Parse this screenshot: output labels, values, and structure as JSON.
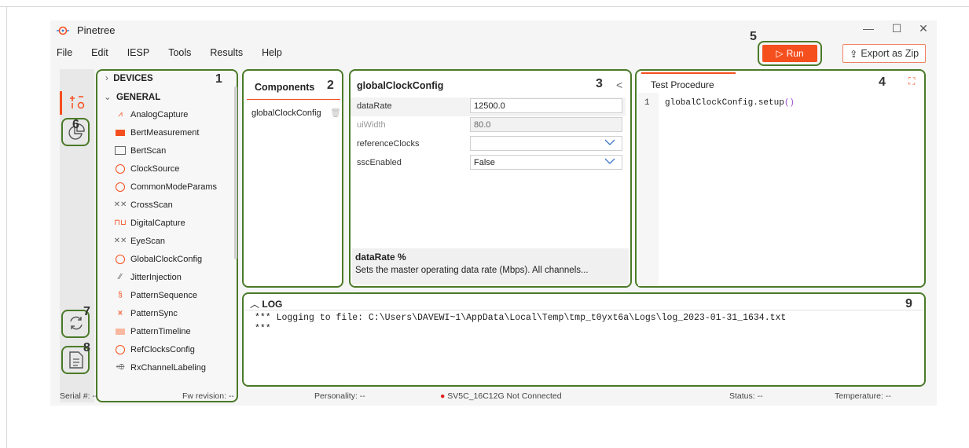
{
  "window": {
    "title": "Pinetree",
    "minimize": "—",
    "maximize": "☐",
    "close": "✕"
  },
  "menu": [
    "File",
    "Edit",
    "IESP",
    "Tools",
    "Results",
    "Help"
  ],
  "toolbar": {
    "run_label": "Run",
    "run_icon": "▷",
    "export_label": "Export as Zip",
    "export_icon": "⇪"
  },
  "colors": {
    "accent": "#f54f1e",
    "callout_border": "#4a7a28",
    "link_blue": "#3a78c8"
  },
  "callouts": {
    "c1": "1",
    "c2": "2",
    "c3": "3",
    "c4": "4",
    "c5": "5",
    "c6": "6",
    "c7": "7",
    "c8": "8",
    "c9": "9"
  },
  "tree": {
    "devices": "DEVICES",
    "general": "GENERAL",
    "items": [
      "AnalogCapture",
      "BertMeasurement",
      "BertScan",
      "ClockSource",
      "CommonModeParams",
      "CrossScan",
      "DigitalCapture",
      "EyeScan",
      "GlobalClockConfig",
      "JitterInjection",
      "PatternSequence",
      "PatternSync",
      "PatternTimeline",
      "RefClocksConfig",
      "RxChannelLabeling"
    ]
  },
  "components": {
    "title": "Components",
    "items": [
      "globalClockConfig"
    ]
  },
  "config": {
    "title": "globalClockConfig",
    "collapse_icon": "<",
    "props": [
      {
        "name": "dataRate",
        "value": "12500.0"
      },
      {
        "name": "uiWidth",
        "value": "80.0"
      },
      {
        "name": "referenceClocks",
        "value": ""
      },
      {
        "name": "sscEnabled",
        "value": "False"
      }
    ],
    "help_title": "dataRate",
    "help_text": "Sets the master operating data rate (Mbps). All channels..."
  },
  "procedure": {
    "tab": "Test Procedure",
    "line_no": "1",
    "code_obj": "globalClockConfig.setup",
    "code_parens": "()"
  },
  "log": {
    "title": "LOG",
    "line1": "*** Logging to file: C:\\Users\\DAVEWI~1\\AppData\\Local\\Temp\\tmp_t0yxt6a\\Logs\\log_2023-01-31_1634.txt",
    "line2": "***"
  },
  "status": {
    "serial": "Serial #:  --",
    "fw": "Fw revision: --",
    "personality": "Personality: --",
    "device": "SV5C_16C12G  Not Connected",
    "status": "Status: --",
    "temperature": "Temperature: --"
  }
}
